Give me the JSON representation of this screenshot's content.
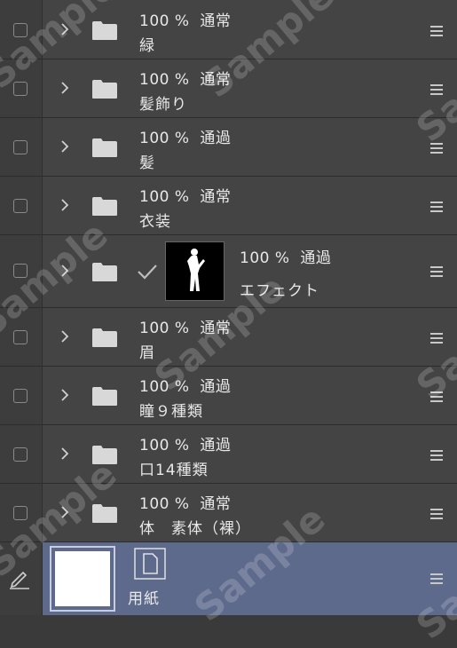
{
  "layers": [
    {
      "opacity": "100 %",
      "blend": "通常",
      "name": "緑"
    },
    {
      "opacity": "100 %",
      "blend": "通常",
      "name": "髪飾り"
    },
    {
      "opacity": "100 %",
      "blend": "通過",
      "name": "髪"
    },
    {
      "opacity": "100 %",
      "blend": "通常",
      "name": "衣装"
    },
    {
      "opacity": "100 %",
      "blend": "通過",
      "name": "エフェクト"
    },
    {
      "opacity": "100 %",
      "blend": "通常",
      "name": "眉"
    },
    {
      "opacity": "100 %",
      "blend": "通過",
      "name": "瞳９種類"
    },
    {
      "opacity": "100 %",
      "blend": "通過",
      "name": "口14種類"
    },
    {
      "opacity": "100 %",
      "blend": "通常",
      "name": "体　素体（裸）"
    }
  ],
  "paper_layer": {
    "name": "用紙"
  },
  "watermark_text": "Sample",
  "colors": {
    "row_bg": "#444444",
    "selected_bg": "#5d6a8c",
    "panel_bg": "#3a3a3a"
  }
}
